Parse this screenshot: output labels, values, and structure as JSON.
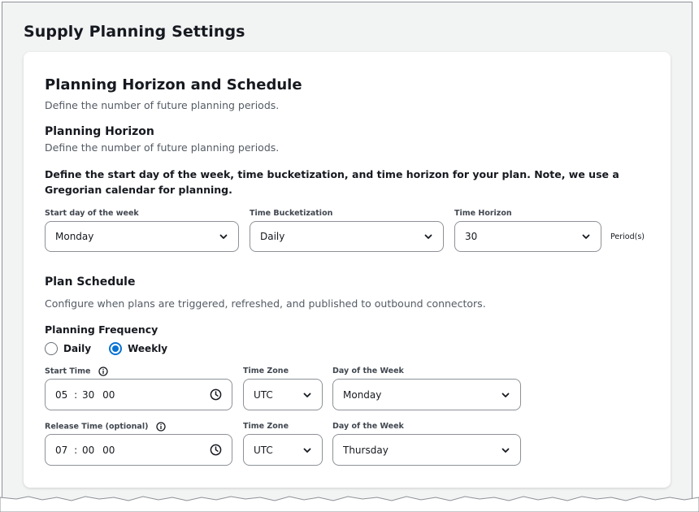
{
  "page": {
    "title": "Supply Planning Settings"
  },
  "section": {
    "title": "Planning Horizon and Schedule",
    "description": "Define the number of future planning periods."
  },
  "horizon": {
    "title": "Planning Horizon",
    "description": "Define the number of future planning periods.",
    "instruction": "Define the start day of the week, time bucketization, and time horizon for your plan. Note, we use a Gregorian calendar for planning.",
    "start_day": {
      "label": "Start day of the week",
      "value": "Monday"
    },
    "bucketization": {
      "label": "Time Bucketization",
      "value": "Daily"
    },
    "time_horizon": {
      "label": "Time Horizon",
      "value": "30",
      "suffix": "Period(s)"
    }
  },
  "schedule": {
    "title": "Plan Schedule",
    "description": "Configure when plans are triggered, refreshed, and published to outbound connectors.",
    "frequency": {
      "label": "Planning Frequency",
      "options": [
        {
          "label": "Daily",
          "checked": false
        },
        {
          "label": "Weekly",
          "checked": true
        }
      ]
    },
    "start": {
      "time_label": "Start Time",
      "hh": "05",
      "mm": "30",
      "ss": "00",
      "tz_label": "Time Zone",
      "tz_value": "UTC",
      "dow_label": "Day of the Week",
      "dow_value": "Monday"
    },
    "release": {
      "time_label": "Release Time (optional)",
      "hh": "07",
      "mm": "00",
      "ss": "00",
      "tz_label": "Time Zone",
      "tz_value": "UTC",
      "dow_label": "Day of the Week",
      "dow_value": "Thursday"
    }
  },
  "colors": {
    "accent": "#0972d3",
    "border": "#8d9196",
    "background": "#f2f3f3"
  },
  "icons": [
    "chevron-down-icon",
    "clock-icon",
    "info-icon"
  ]
}
